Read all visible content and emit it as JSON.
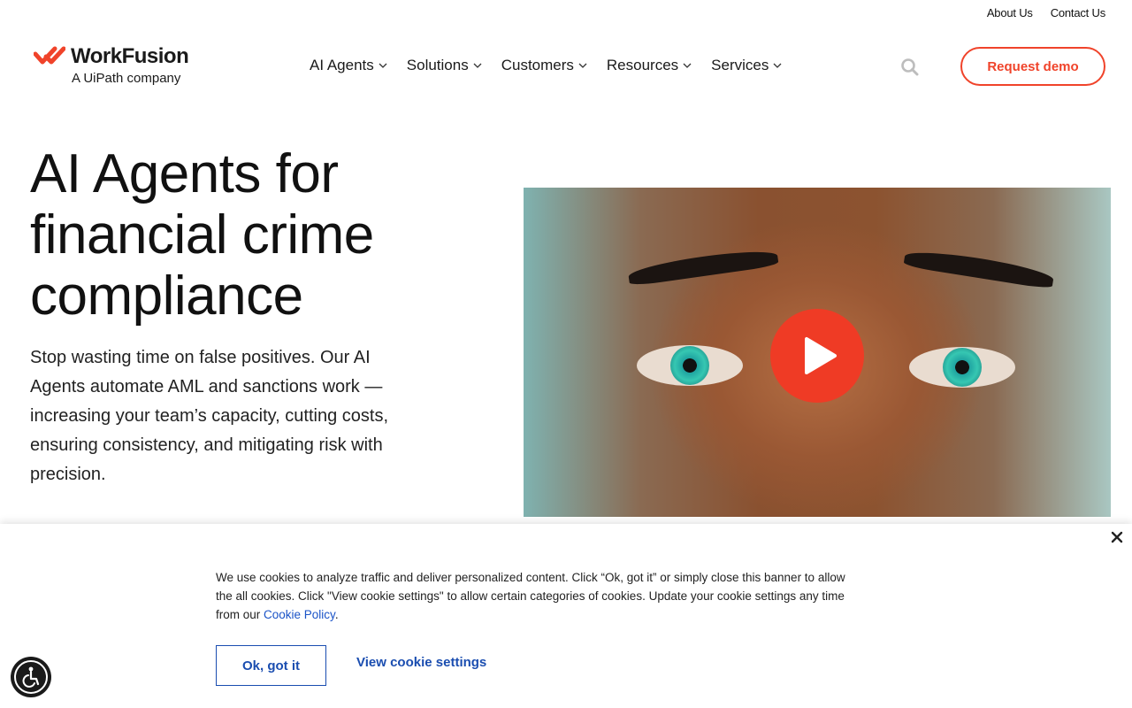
{
  "utility_nav": {
    "about": "About Us",
    "contact": "Contact Us"
  },
  "logo": {
    "name": "WorkFusion",
    "tagline": "A UiPath company"
  },
  "nav": {
    "items": [
      {
        "label": "AI Agents"
      },
      {
        "label": "Solutions"
      },
      {
        "label": "Customers"
      },
      {
        "label": "Resources"
      },
      {
        "label": "Services"
      }
    ],
    "cta": "Request demo"
  },
  "hero": {
    "title": "AI Agents for financial crime compliance",
    "subtitle": "Stop wasting time on false positives. Our AI Agents automate AML and sanctions work — increasing your team’s capacity, cutting costs, ensuring consistency, and mitigating risk with precision."
  },
  "cookie_banner": {
    "text": "We use cookies to analyze traffic and deliver personalized content. Click “Ok, got it” or simply close this banner to allow the all cookies. Click \"View cookie settings\" to allow certain categories of cookies. Update your cookie settings any time from our ",
    "policy_link": "Cookie Policy",
    "ok": "Ok, got it",
    "settings": "View cookie settings"
  },
  "colors": {
    "accent": "#f0432a",
    "link": "#1a4db0"
  }
}
